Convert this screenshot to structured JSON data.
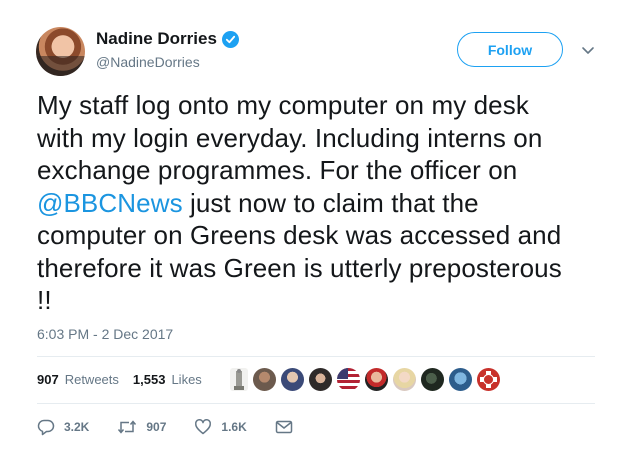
{
  "author": {
    "name": "Nadine Dorries",
    "handle": "@NadineDorries",
    "verified": true
  },
  "follow_label": "Follow",
  "tweet": {
    "lines": [
      "My staff log onto my computer on my desk",
      "with my login everyday. Including interns on",
      "exchange programmes. For the officer on",
      [
        "@BBCNews",
        " just now to claim that the"
      ],
      "computer on Greens desk was accessed and",
      "therefore it was Green is utterly preposterous",
      "!!"
    ],
    "mention": "@BBCNews",
    "line4_rest": " just now to claim that the"
  },
  "timestamp": "6:03 PM - 2 Dec 2017",
  "stats": {
    "retweets_count": "907",
    "retweets_label": "Retweets",
    "likes_count": "1,553",
    "likes_label": "Likes"
  },
  "liker_avatars": 10,
  "actions": {
    "replies": "3.2K",
    "retweets": "907",
    "likes": "1.6K"
  },
  "colors": {
    "accent": "#1da1f2",
    "link": "#1b95e0",
    "muted": "#657786",
    "text": "#14171a"
  },
  "icons": [
    "verified-icon",
    "chevron-down-icon",
    "reply-icon",
    "retweet-icon",
    "like-icon",
    "message-icon"
  ]
}
